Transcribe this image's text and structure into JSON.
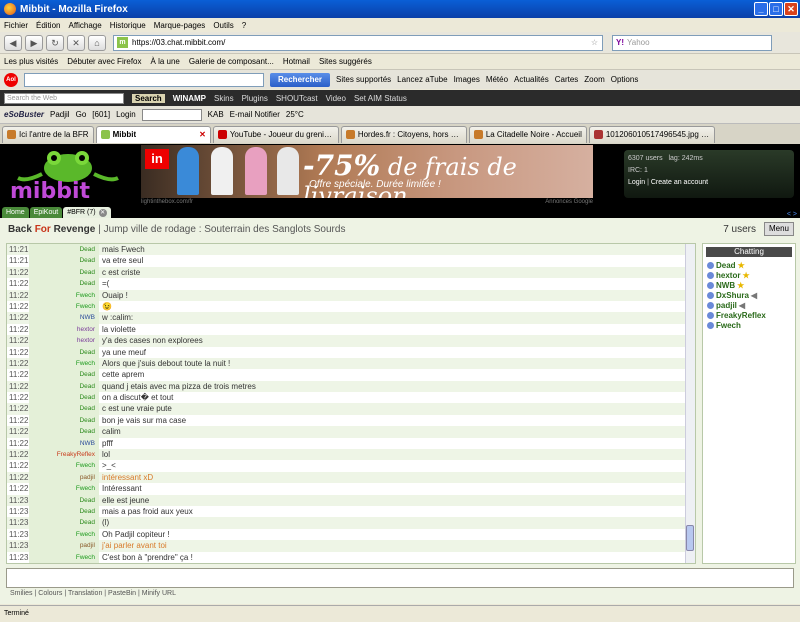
{
  "window": {
    "title": "Mibbit - Mozilla Firefox",
    "controls": [
      "_",
      "□",
      "✕"
    ]
  },
  "menu": [
    "Fichier",
    "Édition",
    "Affichage",
    "Historique",
    "Marque-pages",
    "Outils",
    "?"
  ],
  "nav": {
    "url": "https://03.chat.mibbit.com/",
    "search_placeholder": "Yahoo",
    "search_logo": "Y!"
  },
  "bookmarks": [
    "Les plus visités",
    "Débuter avec Firefox",
    "À la une",
    "Galerie de composant...",
    "Hotmail",
    "Sites suggérés"
  ],
  "toolbar1": {
    "logo": "Aol",
    "go": "Rechercher",
    "items": [
      "Sites supportés",
      "Lancez aTube",
      "Images",
      "Météo",
      "Actualités",
      "Cartes",
      "Zoom",
      "Options"
    ]
  },
  "toolbar2": {
    "placeholder": "Search the Web",
    "search": "Search",
    "winamp": "WINAMP",
    "items": [
      "Skins",
      "Plugins",
      "SHOUTcast",
      "Video",
      "Set AIM Status"
    ]
  },
  "toolbar3": {
    "brand": "eSoBuster",
    "user": "Padjil",
    "go": "Go",
    "count": "[601]",
    "login": "Login",
    "kab": "KAB",
    "notifier": "E-mail Notifier",
    "temp": "25°C"
  },
  "tabs": [
    {
      "label": "Ici l'antre de la BFR",
      "active": false
    },
    {
      "label": "Mibbit",
      "active": true
    },
    {
      "label": "YouTube - Joueur du grenier ...",
      "active": false
    },
    {
      "label": "Hordes.fr : Citoyens, hors de...",
      "active": false
    },
    {
      "label": "La Citadelle Noire - Accueil",
      "active": false
    },
    {
      "label": "101206010517496545.jpg (I...",
      "active": false
    }
  ],
  "banner": {
    "logo": "mibbit",
    "ad": {
      "brand": "in",
      "headline_pct": "-75%",
      "headline_rest": " de frais de livraison",
      "sub": "Offre spéciale. Durée limitée !",
      "url": "lightinthebox.com/fr",
      "credit": "Annonces Google"
    },
    "users": "6307 users",
    "lag": "lag: 242ms",
    "irc": "IRC: 1",
    "login": "Login",
    "create": "Create an account"
  },
  "room_tabs": [
    {
      "label": "Home",
      "active": false
    },
    {
      "label": "EpiKout",
      "active": false
    },
    {
      "label": "#BFR (7)",
      "active": true
    }
  ],
  "room": {
    "name_p1": "Back ",
    "name_red": "For",
    "name_p2": " Revenge",
    "topic": "| Jump ville de rodage : Souterrain des Sanglots Sourds",
    "user_count": "7 users",
    "menu": "Menu"
  },
  "messages": [
    {
      "time": "11:21",
      "nick": "Dead",
      "text": "mais Fwech",
      "nc": "#2a8a1a",
      "tc": "#333"
    },
    {
      "time": "11:21",
      "nick": "Dead",
      "text": "va etre seul",
      "nc": "#2a8a1a",
      "tc": "#333"
    },
    {
      "time": "11:22",
      "nick": "Dead",
      "text": "c est criste",
      "nc": "#2a8a1a",
      "tc": "#333"
    },
    {
      "time": "11:22",
      "nick": "Dead",
      "text": "=(",
      "nc": "#2a8a1a",
      "tc": "#333"
    },
    {
      "time": "11:22",
      "nick": "Fwech",
      "text": "Ouaip !",
      "nc": "#1a9a1a",
      "tc": "#333"
    },
    {
      "time": "11:22",
      "nick": "Fwech",
      "text": "😉",
      "nc": "#1a9a1a",
      "tc": "#333"
    },
    {
      "time": "11:22",
      "nick": "NWB",
      "text": "w :calim:",
      "nc": "#2a4a9a",
      "tc": "#333"
    },
    {
      "time": "11:22",
      "nick": "hextor",
      "text": "la violette",
      "nc": "#7a3a9a",
      "tc": "#333"
    },
    {
      "time": "11:22",
      "nick": "hextor",
      "text": "y'a des cases non explorees",
      "nc": "#7a3a9a",
      "tc": "#333"
    },
    {
      "time": "11:22",
      "nick": "Dead",
      "text": "ya une meuf",
      "nc": "#2a8a1a",
      "tc": "#333"
    },
    {
      "time": "11:22",
      "nick": "Fwech",
      "text": "Alors que j'suis debout toute la nuit !",
      "nc": "#1a9a1a",
      "tc": "#333"
    },
    {
      "time": "11:22",
      "nick": "Dead",
      "text": "cette aprem",
      "nc": "#2a8a1a",
      "tc": "#333"
    },
    {
      "time": "11:22",
      "nick": "Dead",
      "text": "quand j etais avec ma pizza de trois metres",
      "nc": "#2a8a1a",
      "tc": "#333"
    },
    {
      "time": "11:22",
      "nick": "Dead",
      "text": "on a discut� et tout",
      "nc": "#2a8a1a",
      "tc": "#333"
    },
    {
      "time": "11:22",
      "nick": "Dead",
      "text": "c est une vraie pute",
      "nc": "#2a8a1a",
      "tc": "#333"
    },
    {
      "time": "11:22",
      "nick": "Dead",
      "text": "bon je vais sur ma case",
      "nc": "#2a8a1a",
      "tc": "#333"
    },
    {
      "time": "11:22",
      "nick": "Dead",
      "text": "calim",
      "nc": "#2a8a1a",
      "tc": "#333"
    },
    {
      "time": "11:22",
      "nick": "NWB",
      "text": "pfff",
      "nc": "#2a4a9a",
      "tc": "#333"
    },
    {
      "time": "11:22",
      "nick": "FreakyReflex",
      "text": "lol",
      "nc": "#c83a1a",
      "tc": "#333"
    },
    {
      "time": "11:22",
      "nick": "Fwech",
      "text": ">_<",
      "nc": "#1a9a1a",
      "tc": "#333"
    },
    {
      "time": "11:22",
      "nick": "padjil",
      "text": "intéressant xD",
      "nc": "#8a5a2a",
      "tc": "#d87a2a"
    },
    {
      "time": "11:22",
      "nick": "Fwech",
      "text": "Intéressant",
      "nc": "#1a9a1a",
      "tc": "#333"
    },
    {
      "time": "11:23",
      "nick": "Dead",
      "text": "elle est jeune",
      "nc": "#2a8a1a",
      "tc": "#333"
    },
    {
      "time": "11:23",
      "nick": "Dead",
      "text": "mais a pas froid aux yeux",
      "nc": "#2a8a1a",
      "tc": "#333"
    },
    {
      "time": "11:23",
      "nick": "Dead",
      "text": "(l)",
      "nc": "#2a8a1a",
      "tc": "#333"
    },
    {
      "time": "11:23",
      "nick": "Fwech",
      "text": "Oh Padjil copiteur !",
      "nc": "#1a9a1a",
      "tc": "#333"
    },
    {
      "time": "11:23",
      "nick": "padjil",
      "text": "j'ai parler avant toi",
      "nc": "#8a5a2a",
      "tc": "#d87a2a"
    },
    {
      "time": "11:23",
      "nick": "Fwech",
      "text": "C'est bon à \"prendre\" ça !",
      "nc": "#1a9a1a",
      "tc": "#333"
    }
  ],
  "chatting": {
    "header": "Chatting",
    "users": [
      {
        "name": "Dead",
        "mark": "★",
        "markcolor": "#e8b800"
      },
      {
        "name": "hextor",
        "mark": "★",
        "markcolor": "#e8b800"
      },
      {
        "name": "NWB",
        "mark": "★",
        "markcolor": "#e8b800"
      },
      {
        "name": "DxShura",
        "mark": "◀",
        "markcolor": "#777"
      },
      {
        "name": "padjil",
        "mark": "◀",
        "markcolor": "#777"
      },
      {
        "name": "FreakyReflex",
        "mark": "",
        "markcolor": "#777"
      },
      {
        "name": "Fwech",
        "mark": "",
        "markcolor": "#777"
      }
    ]
  },
  "bottom_links": "Smilies | Colours | Translation | PasteBin | Minify URL",
  "status": "Terminé"
}
